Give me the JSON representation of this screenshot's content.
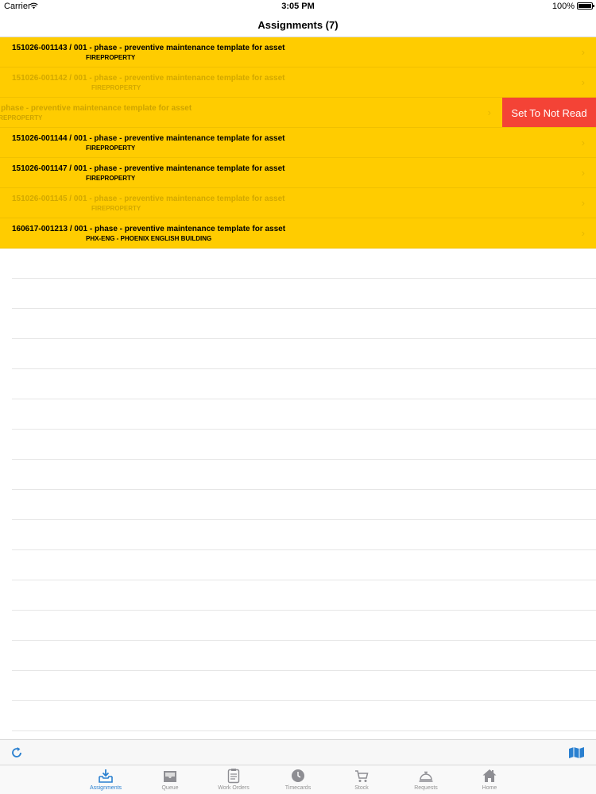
{
  "status_bar": {
    "carrier": "Carrier",
    "time": "3:05 PM",
    "battery": "100%"
  },
  "nav": {
    "title": "Assignments (7)"
  },
  "rows": [
    {
      "title": "151026-001143 / 001 - phase - preventive maintenance template for asset",
      "location": "FIREPROPERTY",
      "state": "normal"
    },
    {
      "title": "151026-001142 / 001 - phase - preventive maintenance template for asset",
      "location": "FIREPROPERTY",
      "state": "faded"
    },
    {
      "title": "- phase - preventive maintenance template for asset",
      "location": "IREPROPERTY",
      "state": "swiped"
    },
    {
      "title": "151026-001144 / 001 - phase - preventive maintenance template for asset",
      "location": "FIREPROPERTY",
      "state": "normal"
    },
    {
      "title": "151026-001147 / 001 - phase - preventive maintenance template for asset",
      "location": "FIREPROPERTY",
      "state": "normal"
    },
    {
      "title": "151026-001145 / 001 - phase - preventive maintenance template for asset",
      "location": "FIREPROPERTY",
      "state": "faded"
    },
    {
      "title": "160617-001213 / 001 - phase - preventive maintenance template for asset",
      "location": "PHX-ENG - PHOENIX ENGLISH BUILDING",
      "state": "normal"
    }
  ],
  "swipe_action": {
    "label": "Set To Not Read",
    "color": "#f44336"
  },
  "colors": {
    "row_highlight": "#ffcc00",
    "accent": "#2a80d0"
  },
  "tabs": [
    {
      "label": "Assignments",
      "icon": "inbox-download-icon",
      "active": true
    },
    {
      "label": "Queue",
      "icon": "tray-icon",
      "active": false
    },
    {
      "label": "Work Orders",
      "icon": "clipboard-icon",
      "active": false
    },
    {
      "label": "Timecards",
      "icon": "clock-icon",
      "active": false
    },
    {
      "label": "Stock",
      "icon": "cart-icon",
      "active": false
    },
    {
      "label": "Requests",
      "icon": "service-bell-icon",
      "active": false
    },
    {
      "label": "Home",
      "icon": "home-icon",
      "active": false
    }
  ],
  "toolbar": {
    "left_icon": "refresh-icon",
    "right_icon": "map-icon"
  }
}
